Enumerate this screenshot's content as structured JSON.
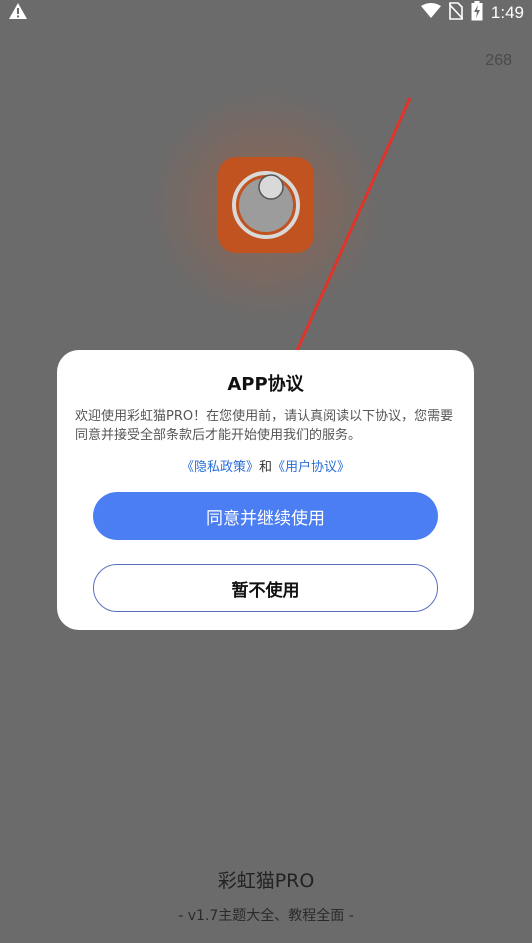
{
  "status_bar": {
    "time": "1:49",
    "icons": [
      "warning-icon",
      "wifi-icon",
      "no-sim-icon",
      "battery-charging-icon"
    ]
  },
  "counter": "268",
  "app": {
    "logo_icon": "app-logo-icon",
    "name": "彩虹猫PRO",
    "subtitle": "- v1.7主题大全、教程全面 -"
  },
  "dialog": {
    "title": "APP协议",
    "body": "欢迎使用彩虹猫PRO！在您使用前，请认真阅读以下协议，您需要同意并接受全部条款后才能开始使用我们的服务。",
    "privacy_link": "《隐私政策》",
    "and_text": "和",
    "user_link": "《用户协议》",
    "agree_label": "同意并继续使用",
    "decline_label": "暂不使用"
  },
  "colors": {
    "overlay": "#6b6b6b",
    "primary": "#4a7ef2",
    "link": "#2a6fd6",
    "logo": "#c0531f",
    "annotation_arrow": "#e0342a"
  }
}
